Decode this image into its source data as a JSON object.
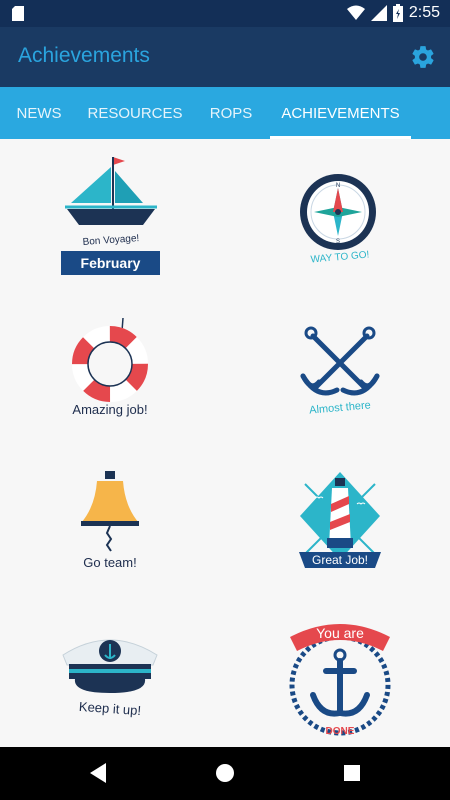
{
  "status_bar": {
    "time": "2:55"
  },
  "app_bar": {
    "title": "Achievements",
    "settings_icon": "gear-icon",
    "accent": "#2aa4de"
  },
  "tabs": [
    {
      "label": "NEWS",
      "active": false
    },
    {
      "label": "RESOURCES",
      "active": false
    },
    {
      "label": "ROPS",
      "active": false
    },
    {
      "label": "ACHIEVEMENTS",
      "active": true
    }
  ],
  "badges": [
    {
      "icon": "sailboat-icon",
      "caption": "Bon Voyage!",
      "month": "February"
    },
    {
      "icon": "compass-icon",
      "caption": "WAY TO GO!"
    },
    {
      "icon": "life-ring-icon",
      "caption": "Amazing job!"
    },
    {
      "icon": "crossed-anchors-icon",
      "caption": "Almost there"
    },
    {
      "icon": "bell-icon",
      "caption": "Go team!"
    },
    {
      "icon": "lighthouse-icon",
      "caption": "Great Job!"
    },
    {
      "icon": "captain-hat-icon",
      "caption": "Keep it up!"
    },
    {
      "icon": "anchor-emblem-icon",
      "caption_top": "You are",
      "caption_bottom": "DONE"
    }
  ],
  "nav": {
    "back": "back-icon",
    "home": "home-icon",
    "recents": "recents-icon"
  }
}
